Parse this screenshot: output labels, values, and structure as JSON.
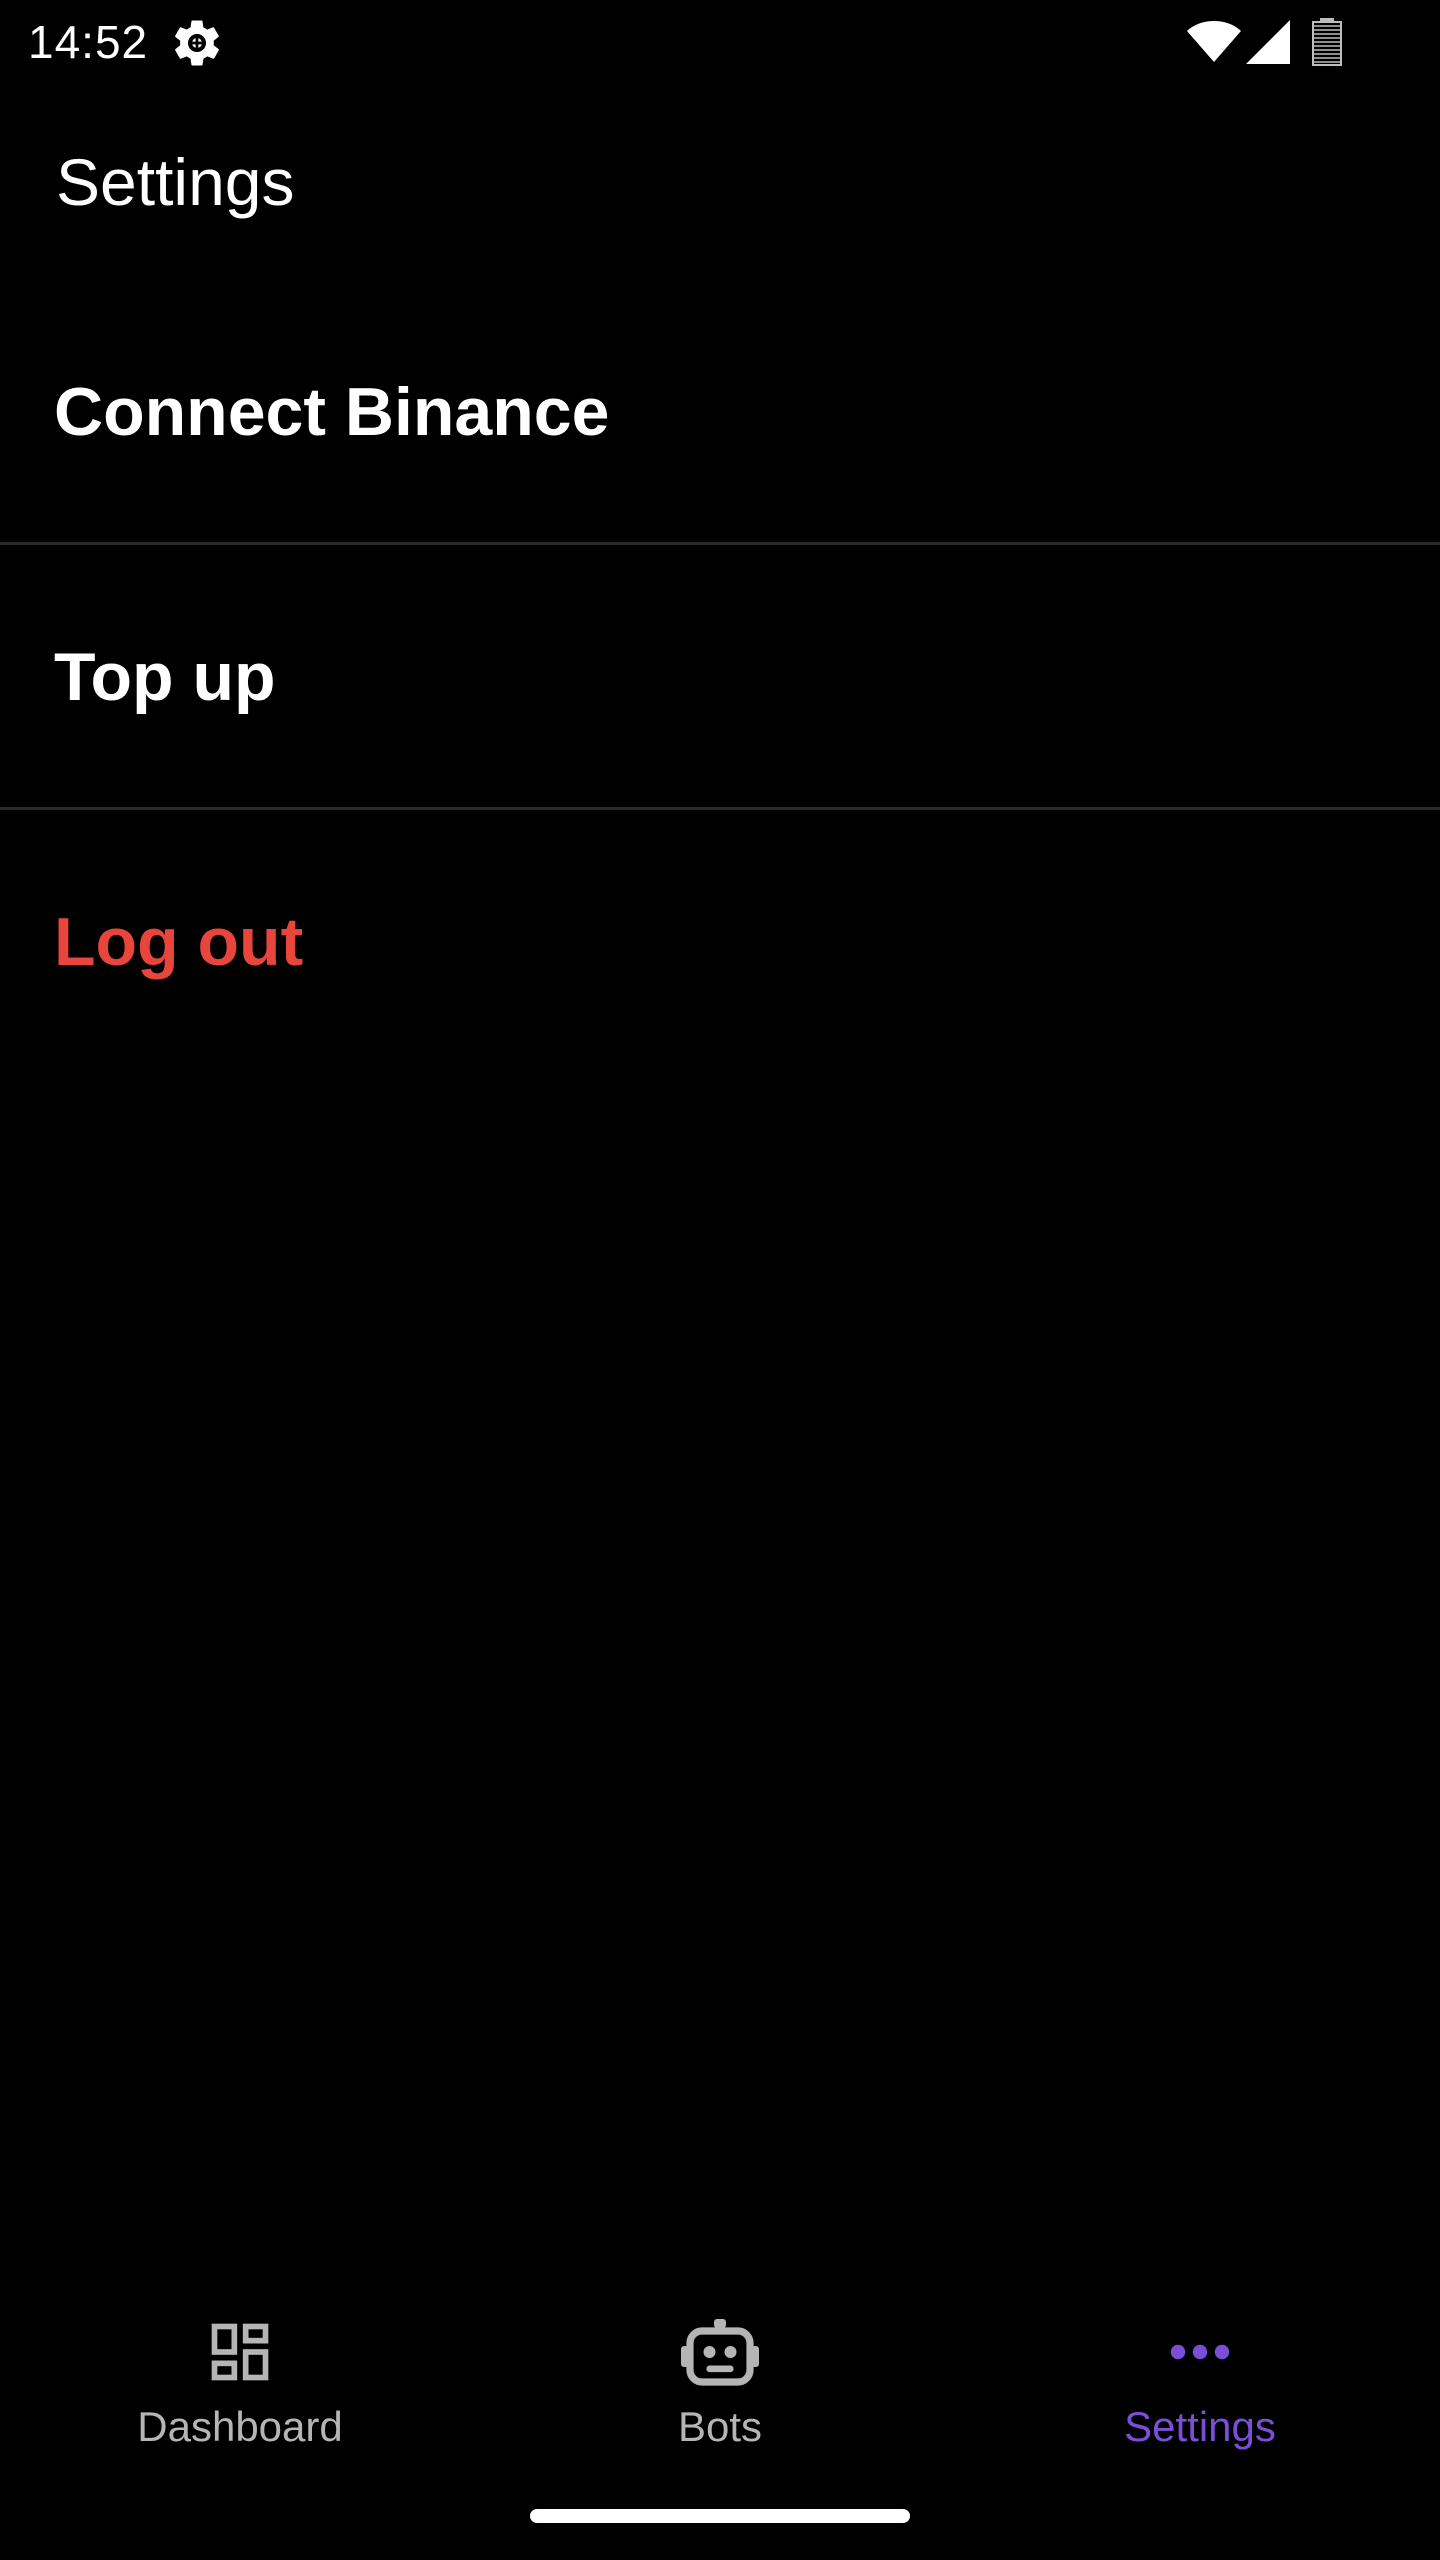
{
  "status_bar": {
    "time": "14:52",
    "icons": [
      "gear-icon",
      "wifi-icon",
      "signal-icon",
      "battery-icon"
    ]
  },
  "header": {
    "title": "Settings"
  },
  "menu": {
    "items": [
      {
        "label": "Connect Binance"
      },
      {
        "label": "Top up"
      },
      {
        "label": "Log out",
        "color": "#e8453c"
      }
    ]
  },
  "bottom_nav": {
    "items": [
      {
        "label": "Dashboard",
        "icon": "dashboard-icon",
        "active": false
      },
      {
        "label": "Bots",
        "icon": "robot-icon",
        "active": false
      },
      {
        "label": "Settings",
        "icon": "more-dots-icon",
        "active": true
      }
    ],
    "active_color": "#7a4fd6",
    "inactive_color": "#b5b5b5"
  }
}
